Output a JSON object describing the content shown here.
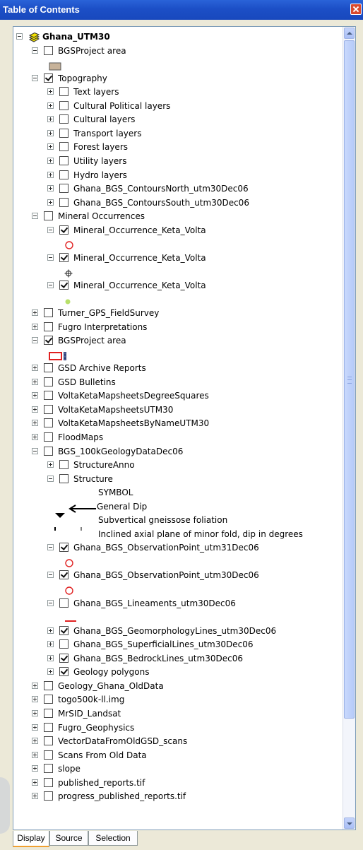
{
  "window": {
    "title": "Table of Contents"
  },
  "tree": [
    {
      "label": "Ghana_UTM30",
      "indent": 0,
      "toggle": "minus",
      "checkbox": null,
      "bold": true,
      "icon": "layers-icon"
    },
    {
      "label": "BGSProject area",
      "indent": 1,
      "toggle": "minus",
      "checkbox": false
    },
    {
      "symbol": "tan-rect-icon",
      "indent": 2
    },
    {
      "label": "Topography",
      "indent": 1,
      "toggle": "minus",
      "checkbox": true
    },
    {
      "label": "Text layers",
      "indent": 2,
      "toggle": "plus",
      "checkbox": false
    },
    {
      "label": "Cultural Political layers",
      "indent": 2,
      "toggle": "plus",
      "checkbox": false
    },
    {
      "label": "Cultural layers",
      "indent": 2,
      "toggle": "plus",
      "checkbox": false
    },
    {
      "label": "Transport layers",
      "indent": 2,
      "toggle": "plus",
      "checkbox": false
    },
    {
      "label": "Forest layers",
      "indent": 2,
      "toggle": "plus",
      "checkbox": false
    },
    {
      "label": "Utility layers",
      "indent": 2,
      "toggle": "plus",
      "checkbox": false
    },
    {
      "label": "Hydro layers",
      "indent": 2,
      "toggle": "plus",
      "checkbox": false
    },
    {
      "label": "Ghana_BGS_ContoursNorth_utm30Dec06",
      "indent": 2,
      "toggle": "plus",
      "checkbox": false
    },
    {
      "label": "Ghana_BGS_ContoursSouth_utm30Dec06",
      "indent": 2,
      "toggle": "plus",
      "checkbox": false
    },
    {
      "label": "Mineral Occurrences",
      "indent": 1,
      "toggle": "minus",
      "checkbox": false
    },
    {
      "label": "Mineral_Occurrence_Keta_Volta",
      "indent": 2,
      "toggle": "minus",
      "checkbox": true
    },
    {
      "symbol": "red-circle-icon",
      "indent": 3
    },
    {
      "label": "Mineral_Occurrence_Keta_Volta",
      "indent": 2,
      "toggle": "minus",
      "checkbox": true
    },
    {
      "symbol": "crosshair-icon",
      "indent": 3
    },
    {
      "label": "Mineral_Occurrence_Keta_Volta",
      "indent": 2,
      "toggle": "minus",
      "checkbox": true
    },
    {
      "symbol": "green-dot-icon",
      "indent": 3
    },
    {
      "label": "Turner_GPS_FieldSurvey",
      "indent": 1,
      "toggle": "plus",
      "checkbox": false
    },
    {
      "label": "Fugro Interpretations",
      "indent": 1,
      "toggle": "plus",
      "checkbox": false
    },
    {
      "label": "BGSProject area",
      "indent": 1,
      "toggle": "minus",
      "checkbox": true
    },
    {
      "symbol": "red-outline-rect-icon",
      "indent": 2
    },
    {
      "label": "GSD Archive Reports",
      "indent": 1,
      "toggle": "plus",
      "checkbox": false
    },
    {
      "label": "GSD Bulletins",
      "indent": 1,
      "toggle": "plus",
      "checkbox": false
    },
    {
      "label": "VoltaKetaMapsheetsDegreeSquares",
      "indent": 1,
      "toggle": "plus",
      "checkbox": false
    },
    {
      "label": "VoltaKetaMapsheetsUTM30",
      "indent": 1,
      "toggle": "plus",
      "checkbox": false
    },
    {
      "label": "VoltaKetaMapsheetsByNameUTM30",
      "indent": 1,
      "toggle": "plus",
      "checkbox": false
    },
    {
      "label": "FloodMaps",
      "indent": 1,
      "toggle": "plus",
      "checkbox": false
    },
    {
      "label": "BGS_100kGeologyDataDec06",
      "indent": 1,
      "toggle": "minus",
      "checkbox": false
    },
    {
      "label": "StructureAnno",
      "indent": 2,
      "toggle": "plus",
      "checkbox": false
    },
    {
      "label": "Structure",
      "indent": 2,
      "toggle": "minus",
      "checkbox": false
    },
    {
      "legend_text": "SYMBOL",
      "indent": "symbol"
    },
    {
      "legend_text": "General Dip",
      "indent": "dip",
      "symbol": "arrow-left-icon"
    },
    {
      "legend_text": "Subvertical gneissose foliation",
      "indent": "foliation",
      "symbol": "triangle-icon"
    },
    {
      "legend_text": "Inclined axial plane of minor fold, dip in degrees",
      "indent": "fold",
      "symbol": "tick-icon"
    },
    {
      "label": "Ghana_BGS_ObservationPoint_utm31Dec06",
      "indent": 2,
      "toggle": "minus",
      "checkbox": true
    },
    {
      "symbol": "red-circle-icon",
      "indent": 3
    },
    {
      "label": "Ghana_BGS_ObservationPoint_utm30Dec06",
      "indent": 2,
      "toggle": "minus",
      "checkbox": true
    },
    {
      "symbol": "red-circle-icon",
      "indent": 3
    },
    {
      "label": "Ghana_BGS_Lineaments_utm30Dec06",
      "indent": 2,
      "toggle": "minus",
      "checkbox": false
    },
    {
      "symbol": "red-line-icon",
      "indent": 3
    },
    {
      "label": "Ghana_BGS_GeomorphologyLines_utm30Dec06",
      "indent": 2,
      "toggle": "plus",
      "checkbox": true
    },
    {
      "label": "Ghana_BGS_SuperficialLines_utm30Dec06",
      "indent": 2,
      "toggle": "plus",
      "checkbox": false
    },
    {
      "label": "Ghana_BGS_BedrockLines_utm30Dec06",
      "indent": 2,
      "toggle": "plus",
      "checkbox": true
    },
    {
      "label": "Geology polygons",
      "indent": 2,
      "toggle": "plus",
      "checkbox": true
    },
    {
      "label": "Geology_Ghana_OldData",
      "indent": 1,
      "toggle": "plus",
      "checkbox": false
    },
    {
      "label": "togo500k-ll.img",
      "indent": 1,
      "toggle": "plus",
      "checkbox": false
    },
    {
      "label": "MrSID_Landsat",
      "indent": 1,
      "toggle": "plus",
      "checkbox": false
    },
    {
      "label": "Fugro_Geophysics",
      "indent": 1,
      "toggle": "plus",
      "checkbox": false
    },
    {
      "label": "VectorDataFromOldGSD_scans",
      "indent": 1,
      "toggle": "plus",
      "checkbox": false
    },
    {
      "label": "Scans From Old Data",
      "indent": 1,
      "toggle": "plus",
      "checkbox": false
    },
    {
      "label": "slope",
      "indent": 1,
      "toggle": "plus",
      "checkbox": false
    },
    {
      "label": "published_reports.tif",
      "indent": 1,
      "toggle": "plus",
      "checkbox": false
    },
    {
      "label": "progress_published_reports.tif",
      "indent": 1,
      "toggle": "plus",
      "checkbox": false
    }
  ],
  "tabs": [
    "Display",
    "Source",
    "Selection"
  ],
  "active_tab": "Display",
  "colors": {
    "titlebar": "#1c4fc6",
    "symbol_red": "#e02020",
    "area_fill": "#c7b299",
    "mineral_green": "#b8e06a"
  }
}
